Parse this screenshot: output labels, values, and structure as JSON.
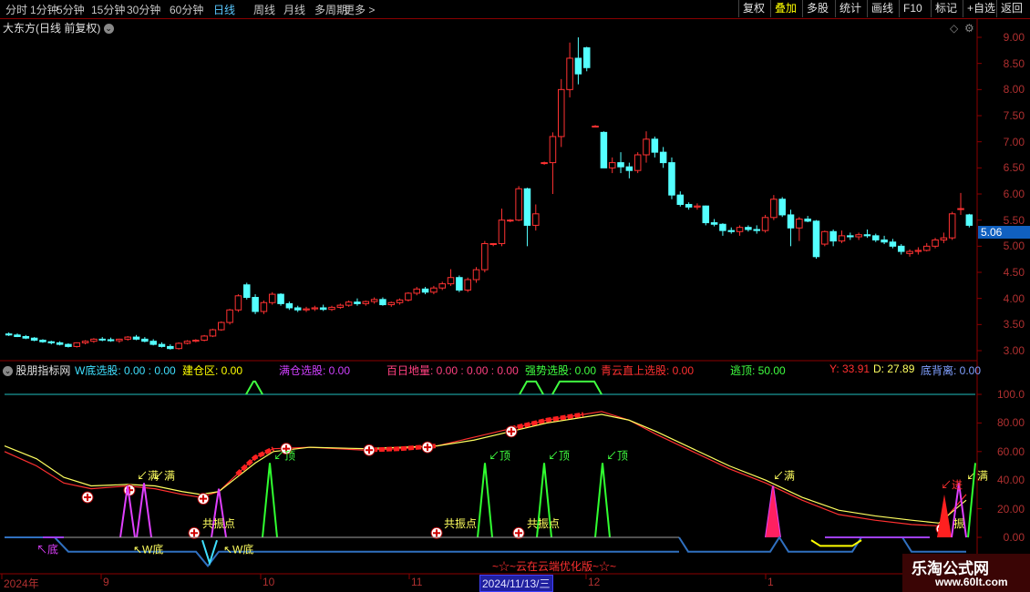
{
  "toolbar": {
    "periods": [
      "分时",
      "1分钟",
      "5分钟",
      "15分钟",
      "30分钟",
      "60分钟",
      "日线",
      "周线",
      "月线",
      "多周期",
      "更多 >"
    ],
    "active_period": "日线",
    "buttons": [
      "复权",
      "叠加",
      "多股",
      "统计",
      "画线",
      "F10",
      "标记",
      "+自选",
      "返回"
    ],
    "active_button": "叠加"
  },
  "price_panel": {
    "title": "大东方(日线 前复权)",
    "current_price": "5.06",
    "axis_labels": [
      "9.00",
      "8.50",
      "8.00",
      "7.50",
      "7.00",
      "6.50",
      "6.00",
      "5.50",
      "5.00",
      "4.50",
      "4.00",
      "3.50",
      "3.00"
    ]
  },
  "indicator_panel": {
    "name": "股朋指标网",
    "readouts": [
      {
        "text": "W底选股: 0.00 : 0.00",
        "color": "#40e0ff"
      },
      {
        "text": "建仓区: 0.00",
        "color": "#ffff00"
      },
      {
        "text": "满仓选股: 0.00",
        "color": "#d040ff"
      },
      {
        "text": "百日地量: 0.00 : 0.00 : 0.00",
        "color": "#ff4080"
      },
      {
        "text": "强势选股: 0.00",
        "color": "#40ff40"
      },
      {
        "text": "青云直上选股: 0.00",
        "color": "#ff3030"
      },
      {
        "text": "逃顶: 50.00",
        "color": "#40ff40"
      },
      {
        "text": "Y: 33.91",
        "color": "#ff3030"
      },
      {
        "text": "D: 27.89",
        "color": "#ffff60"
      },
      {
        "text": "底背离: 0.00",
        "color": "#80a0ff"
      }
    ],
    "axis_labels": [
      "100.0",
      "80.00",
      "60.00",
      "40.00",
      "20.00",
      "0.00"
    ],
    "annotations": {
      "man": "满",
      "ding": "顶",
      "gongzhen": "共振点",
      "wdi": "W底",
      "di": "底",
      "zhen": "振",
      "jin": "进"
    },
    "banner": "~☆~云在云端优化版~☆~"
  },
  "date_axis": {
    "labels": [
      "2024年",
      "9",
      "10",
      "11",
      "12",
      "1"
    ],
    "highlight": "2024/11/13/三"
  },
  "watermark": {
    "line1": "乐淘公式网",
    "line2": "www.60lt.com"
  },
  "colors": {
    "up": "#ff3232",
    "down": "#54ffff",
    "grid": "#8b0000",
    "y_line": "#ff3030",
    "d_line": "#ffff60"
  },
  "chart_data": {
    "type": "candlestick",
    "ylim": [
      2.8,
      9.2
    ],
    "candles": [
      [
        3.32,
        3.35,
        3.28,
        3.3
      ],
      [
        3.3,
        3.33,
        3.26,
        3.27
      ],
      [
        3.27,
        3.3,
        3.22,
        3.24
      ],
      [
        3.24,
        3.26,
        3.18,
        3.2
      ],
      [
        3.2,
        3.22,
        3.15,
        3.17
      ],
      [
        3.17,
        3.19,
        3.12,
        3.15
      ],
      [
        3.15,
        3.18,
        3.1,
        3.12
      ],
      [
        3.12,
        3.14,
        3.06,
        3.08
      ],
      [
        3.08,
        3.16,
        3.06,
        3.15
      ],
      [
        3.15,
        3.2,
        3.12,
        3.18
      ],
      [
        3.18,
        3.24,
        3.15,
        3.22
      ],
      [
        3.22,
        3.26,
        3.18,
        3.21
      ],
      [
        3.21,
        3.25,
        3.17,
        3.19
      ],
      [
        3.19,
        3.23,
        3.15,
        3.22
      ],
      [
        3.22,
        3.28,
        3.19,
        3.26
      ],
      [
        3.26,
        3.3,
        3.2,
        3.22
      ],
      [
        3.22,
        3.26,
        3.16,
        3.18
      ],
      [
        3.18,
        3.22,
        3.1,
        3.12
      ],
      [
        3.12,
        3.16,
        3.06,
        3.08
      ],
      [
        3.08,
        3.12,
        3.02,
        3.04
      ],
      [
        3.04,
        3.16,
        3.02,
        3.14
      ],
      [
        3.14,
        3.2,
        3.12,
        3.18
      ],
      [
        3.18,
        3.22,
        3.16,
        3.2
      ],
      [
        3.2,
        3.3,
        3.18,
        3.28
      ],
      [
        3.28,
        3.42,
        3.26,
        3.4
      ],
      [
        3.4,
        3.56,
        3.38,
        3.54
      ],
      [
        3.54,
        3.8,
        3.5,
        3.78
      ],
      [
        3.78,
        4.08,
        3.74,
        4.05
      ],
      [
        4.26,
        4.3,
        3.98,
        4.02
      ],
      [
        4.02,
        4.08,
        3.7,
        3.75
      ],
      [
        3.75,
        3.96,
        3.7,
        3.92
      ],
      [
        3.92,
        4.12,
        3.88,
        4.08
      ],
      [
        4.08,
        4.1,
        3.86,
        3.9
      ],
      [
        3.9,
        3.94,
        3.78,
        3.82
      ],
      [
        3.82,
        3.86,
        3.74,
        3.78
      ],
      [
        3.78,
        3.84,
        3.74,
        3.8
      ],
      [
        3.8,
        3.86,
        3.76,
        3.82
      ],
      [
        3.82,
        3.88,
        3.76,
        3.79
      ],
      [
        3.79,
        3.86,
        3.76,
        3.83
      ],
      [
        3.83,
        3.9,
        3.8,
        3.87
      ],
      [
        3.87,
        3.96,
        3.84,
        3.93
      ],
      [
        3.93,
        4.0,
        3.86,
        3.9
      ],
      [
        3.9,
        3.96,
        3.86,
        3.94
      ],
      [
        3.94,
        4.02,
        3.9,
        3.98
      ],
      [
        3.98,
        4.02,
        3.86,
        3.88
      ],
      [
        3.88,
        3.94,
        3.84,
        3.92
      ],
      [
        3.92,
        4.0,
        3.88,
        3.97
      ],
      [
        3.97,
        4.12,
        3.94,
        4.1
      ],
      [
        4.1,
        4.22,
        4.06,
        4.18
      ],
      [
        4.18,
        4.22,
        4.08,
        4.12
      ],
      [
        4.12,
        4.24,
        4.08,
        4.2
      ],
      [
        4.2,
        4.32,
        4.16,
        4.28
      ],
      [
        4.28,
        4.56,
        4.24,
        4.4
      ],
      [
        4.4,
        4.44,
        4.12,
        4.16
      ],
      [
        4.16,
        4.4,
        4.12,
        4.36
      ],
      [
        4.36,
        4.6,
        4.3,
        4.55
      ],
      [
        4.55,
        5.1,
        4.5,
        5.05
      ],
      [
        5.05,
        5.06,
        5.0,
        5.05
      ],
      [
        5.05,
        5.72,
        5.0,
        5.5
      ],
      [
        5.5,
        5.52,
        5.46,
        5.5
      ],
      [
        5.5,
        6.15,
        5.48,
        6.1
      ],
      [
        6.1,
        6.12,
        5.0,
        5.4
      ],
      [
        5.4,
        5.8,
        5.3,
        5.62
      ],
      [
        6.6,
        6.62,
        6.56,
        6.6
      ],
      [
        6.6,
        7.18,
        6.0,
        7.1
      ],
      [
        7.1,
        8.2,
        6.9,
        8.0
      ],
      [
        8.0,
        8.9,
        7.85,
        8.6
      ],
      [
        8.6,
        9.0,
        8.1,
        8.3
      ],
      [
        8.8,
        8.82,
        8.35,
        8.42
      ],
      [
        7.3,
        7.32,
        7.28,
        7.3
      ],
      [
        7.18,
        7.2,
        6.5,
        6.5
      ],
      [
        6.5,
        6.7,
        6.4,
        6.6
      ],
      [
        6.6,
        6.8,
        6.4,
        6.52
      ],
      [
        6.52,
        6.6,
        6.3,
        6.45
      ],
      [
        6.45,
        6.8,
        6.4,
        6.75
      ],
      [
        6.75,
        7.2,
        6.6,
        7.05
      ],
      [
        7.05,
        7.1,
        6.7,
        6.8
      ],
      [
        6.8,
        6.9,
        6.5,
        6.6
      ],
      [
        6.6,
        6.7,
        5.9,
        5.98
      ],
      [
        5.98,
        6.05,
        5.76,
        5.8
      ],
      [
        5.8,
        5.84,
        5.7,
        5.75
      ],
      [
        5.75,
        5.82,
        5.7,
        5.77
      ],
      [
        5.77,
        5.78,
        5.4,
        5.45
      ],
      [
        5.45,
        5.52,
        5.38,
        5.42
      ],
      [
        5.42,
        5.44,
        5.2,
        5.3
      ],
      [
        5.3,
        5.36,
        5.24,
        5.28
      ],
      [
        5.28,
        5.4,
        5.2,
        5.36
      ],
      [
        5.36,
        5.4,
        5.28,
        5.32
      ],
      [
        5.32,
        5.4,
        5.24,
        5.3
      ],
      [
        5.3,
        5.6,
        5.26,
        5.55
      ],
      [
        5.55,
        5.98,
        5.5,
        5.9
      ],
      [
        5.9,
        5.94,
        5.56,
        5.6
      ],
      [
        5.6,
        5.7,
        5.0,
        5.35
      ],
      [
        5.35,
        5.56,
        5.1,
        5.52
      ],
      [
        5.52,
        5.58,
        5.46,
        5.48
      ],
      [
        5.48,
        5.5,
        4.76,
        4.8
      ],
      [
        5.04,
        5.3,
        5.0,
        5.28
      ],
      [
        5.28,
        5.32,
        5.0,
        5.1
      ],
      [
        5.1,
        5.3,
        5.06,
        5.2
      ],
      [
        5.2,
        5.26,
        5.12,
        5.18
      ],
      [
        5.18,
        5.26,
        5.12,
        5.22
      ],
      [
        5.22,
        5.32,
        5.16,
        5.2
      ],
      [
        5.2,
        5.24,
        5.08,
        5.12
      ],
      [
        5.12,
        5.2,
        5.04,
        5.08
      ],
      [
        5.08,
        5.14,
        4.96,
        5.0
      ],
      [
        5.0,
        5.04,
        4.84,
        4.9
      ],
      [
        4.86,
        4.94,
        4.8,
        4.9
      ],
      [
        4.9,
        4.98,
        4.84,
        4.92
      ],
      [
        4.92,
        5.06,
        4.9,
        5.0
      ],
      [
        5.0,
        5.16,
        4.96,
        5.12
      ],
      [
        5.12,
        5.26,
        5.06,
        5.16
      ],
      [
        5.16,
        5.66,
        5.12,
        5.62
      ],
      [
        5.72,
        6.02,
        5.6,
        5.72
      ],
      [
        5.6,
        5.62,
        5.36,
        5.4
      ]
    ]
  }
}
